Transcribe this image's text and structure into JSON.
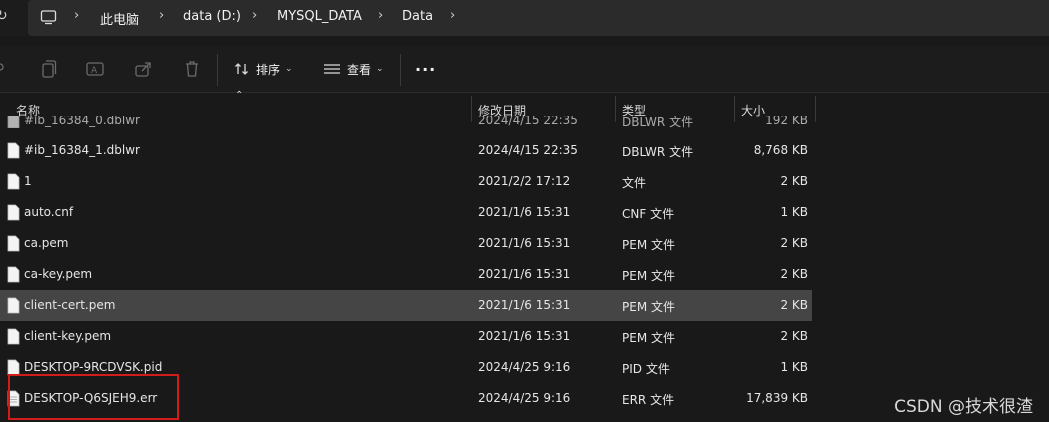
{
  "breadcrumb": {
    "items": [
      "此电脑",
      "data (D:)",
      "MYSQL_DATA",
      "Data"
    ]
  },
  "toolbar": {
    "sort_label": "排序",
    "view_label": "查看",
    "more_label": "···"
  },
  "columns": {
    "name": "名称",
    "date": "修改日期",
    "type": "类型",
    "size": "大小"
  },
  "partial_row": {
    "name": "#ib_16384_0.dblwr",
    "date": "2024/4/15 22:35",
    "type": "DBLWR 文件",
    "size": "192 KB"
  },
  "files": [
    {
      "name": "#ib_16384_1.dblwr",
      "date": "2024/4/15 22:35",
      "type": "DBLWR 文件",
      "size": "8,768 KB"
    },
    {
      "name": "1",
      "date": "2021/2/2 17:12",
      "type": "文件",
      "size": "2 KB"
    },
    {
      "name": "auto.cnf",
      "date": "2021/1/6 15:31",
      "type": "CNF 文件",
      "size": "1 KB"
    },
    {
      "name": "ca.pem",
      "date": "2021/1/6 15:31",
      "type": "PEM 文件",
      "size": "2 KB"
    },
    {
      "name": "ca-key.pem",
      "date": "2021/1/6 15:31",
      "type": "PEM 文件",
      "size": "2 KB"
    },
    {
      "name": "client-cert.pem",
      "date": "2021/1/6 15:31",
      "type": "PEM 文件",
      "size": "2 KB"
    },
    {
      "name": "client-key.pem",
      "date": "2021/1/6 15:31",
      "type": "PEM 文件",
      "size": "2 KB"
    },
    {
      "name": "DESKTOP-9RCDVSK.pid",
      "date": "2024/4/25 9:16",
      "type": "PID 文件",
      "size": "1 KB"
    },
    {
      "name": "DESKTOP-Q6SJEH9.err",
      "date": "2024/4/25 9:16",
      "type": "ERR 文件",
      "size": "17,839 KB"
    }
  ],
  "watermark": "CSDN @技术很渣",
  "colors": {
    "background": "#191919",
    "selected_row": "#454545",
    "highlight_box": "#d11c1c"
  }
}
